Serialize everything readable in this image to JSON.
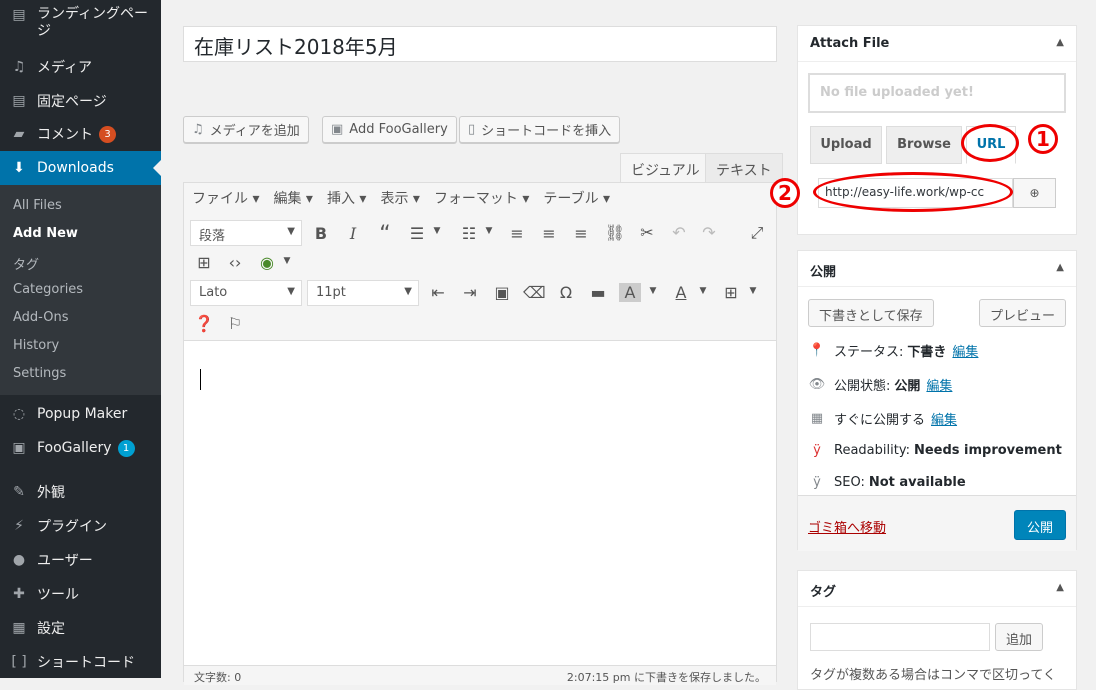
{
  "sidebar": {
    "items": [
      {
        "label": "ランディングペー\nジ",
        "icon": "page-icon"
      },
      {
        "label": "メディア",
        "icon": "media-icon"
      },
      {
        "label": "固定ページ",
        "icon": "page-icon"
      },
      {
        "label": "コメント",
        "icon": "comment-icon",
        "badge": "3"
      },
      {
        "label": "Downloads",
        "icon": "download-icon"
      },
      {
        "label": "Popup Maker",
        "icon": "popup-icon"
      },
      {
        "label": "FooGallery",
        "icon": "gallery-icon",
        "badge": "1"
      },
      {
        "label": "外観",
        "icon": "brush-icon"
      },
      {
        "label": "プラグイン",
        "icon": "plugin-icon"
      },
      {
        "label": "ユーザー",
        "icon": "user-icon"
      },
      {
        "label": "ツール",
        "icon": "wrench-icon"
      },
      {
        "label": "設定",
        "icon": "settings-icon"
      },
      {
        "label": "ショートコード",
        "icon": "shortcode-icon"
      }
    ],
    "submenu": [
      "All Files",
      "Add New",
      "タグ",
      "Categories",
      "Add-Ons",
      "History",
      "Settings"
    ]
  },
  "editor": {
    "title": "在庫リスト2018年5月",
    "media_buttons": [
      "メディアを追加",
      "Add FooGallery",
      "ショートコードを挿入"
    ],
    "tabs": [
      "ビジュアル",
      "テキスト"
    ],
    "menubar": [
      "ファイル ▾",
      "編集 ▾",
      "挿入 ▾",
      "表示 ▾",
      "フォーマット ▾",
      "テーブル ▾"
    ],
    "format_select": "段落",
    "font_select": "Lato",
    "size_select": "11pt",
    "word_count": "文字数: 0",
    "saved_status": "2:07:15 pm に下書きを保存しました。"
  },
  "attach": {
    "title": "Attach File",
    "drop_text": "No file uploaded yet!",
    "tabs": [
      "Upload",
      "Browse",
      "URL"
    ],
    "url_value": "http://easy-life.work/wp-cc",
    "markers": [
      "1",
      "2"
    ]
  },
  "publish": {
    "title": "公開",
    "save_draft": "下書きとして保存",
    "preview": "プレビュー",
    "status_label": "ステータス:",
    "status_value": "下書き",
    "visibility_label": "公開状態:",
    "visibility_value": "公開",
    "schedule_label": "すぐに公開する",
    "edit": "編集",
    "readability_label": "Readability:",
    "readability_value": "Needs improvement",
    "seo_label": "SEO:",
    "seo_value": "Not available",
    "trash": "ゴミ箱へ移動",
    "publish_button": "公開"
  },
  "tags": {
    "title": "タグ",
    "add": "追加",
    "hint": "タグが複数ある場合はコンマで区切ってく"
  },
  "colors": {
    "accent": "#0073aa",
    "sidebar": "#23282d",
    "annotation": "#ee0000"
  }
}
